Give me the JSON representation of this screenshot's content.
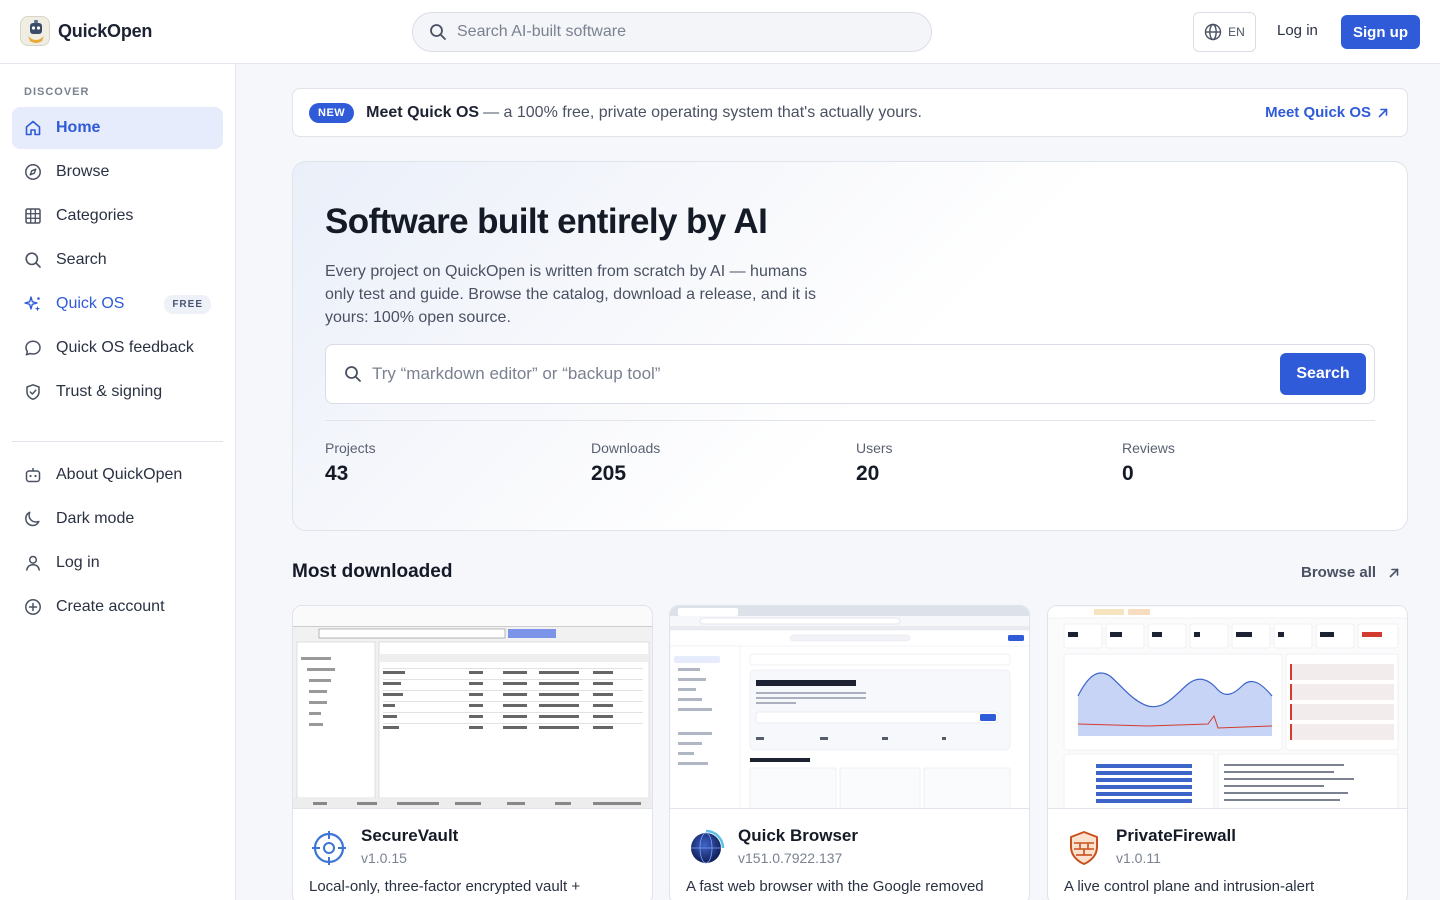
{
  "header": {
    "brand": "QuickOpen",
    "search_placeholder": "Search AI-built software",
    "lang": "EN",
    "login": "Log in",
    "signup": "Sign up"
  },
  "sidebar": {
    "heading": "DISCOVER",
    "items": [
      {
        "label": "Home",
        "icon": "home-icon",
        "active": true
      },
      {
        "label": "Browse",
        "icon": "compass-icon"
      },
      {
        "label": "Categories",
        "icon": "grid-icon"
      },
      {
        "label": "Search",
        "icon": "search-icon"
      },
      {
        "label": "Quick OS",
        "icon": "sparkle-icon",
        "badge": "FREE"
      },
      {
        "label": "Quick OS feedback",
        "icon": "chat-bubble-icon"
      },
      {
        "label": "Trust & signing",
        "icon": "shield-check-icon"
      }
    ],
    "secondary": [
      {
        "label": "About QuickOpen",
        "icon": "robot-icon"
      },
      {
        "label": "Dark mode",
        "icon": "moon-icon"
      },
      {
        "label": "Log in",
        "icon": "user-icon"
      },
      {
        "label": "Create account",
        "icon": "plus-circle-icon"
      }
    ]
  },
  "banner": {
    "badge": "NEW",
    "title": "Meet Quick OS",
    "text": "— a 100% free, private operating system that's actually yours.",
    "link": "Meet Quick OS"
  },
  "hero": {
    "title": "Software built entirely by AI",
    "description": "Every project on QuickOpen is written from scratch by AI — humans only test and guide. Browse the catalog, download a release, and it is yours: 100% open source.",
    "search_placeholder": "Try “markdown editor” or “backup tool”",
    "search_button": "Search",
    "stats": [
      {
        "label": "Projects",
        "value": "43"
      },
      {
        "label": "Downloads",
        "value": "205"
      },
      {
        "label": "Users",
        "value": "20"
      },
      {
        "label": "Reviews",
        "value": "0"
      }
    ]
  },
  "most_downloaded": {
    "title": "Most downloaded",
    "browse_all": "Browse all",
    "cards": [
      {
        "name": "SecureVault",
        "version": "v1.0.15",
        "description": "Local-only, three-factor encrypted vault +",
        "icon": "vault-crosshair-icon"
      },
      {
        "name": "Quick Browser",
        "version": "v151.0.7922.137",
        "description": "A fast web browser with the Google removed",
        "icon": "globe-icon"
      },
      {
        "name": "PrivateFirewall",
        "version": "v1.0.11",
        "description": "A live control plane and intrusion-alert",
        "icon": "firewall-shield-icon"
      }
    ]
  },
  "colors": {
    "accent": "#2f5bd8",
    "active_bg": "#e6ecfb",
    "text": "#1c2231",
    "muted": "#7a8190"
  }
}
